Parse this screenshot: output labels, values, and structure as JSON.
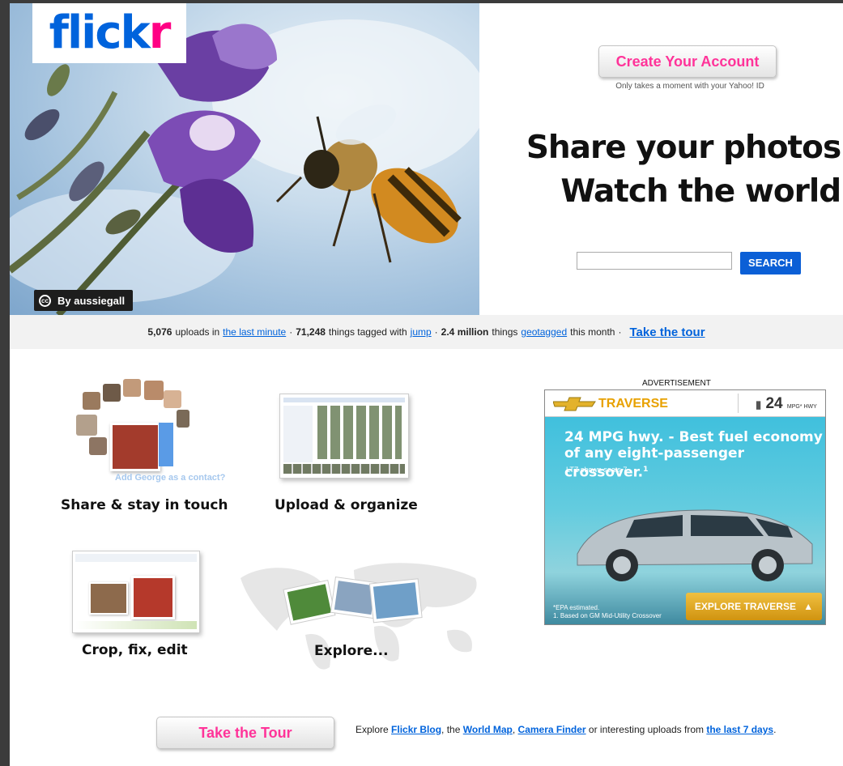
{
  "logo": {
    "flick": "flick",
    "r": "r"
  },
  "hero": {
    "credit": "By aussiegall",
    "cc_icon": "cc-icon"
  },
  "account": {
    "create_label": "Create Your Account",
    "note": "Only takes a moment with your Yahoo! ID"
  },
  "headline": {
    "line1": "Share your photos.",
    "line2": "Watch the world."
  },
  "search": {
    "placeholder": "",
    "button_label": "SEARCH"
  },
  "stats": {
    "uploads_count": "5,076",
    "uploads_text": "uploads in",
    "uploads_link": "the last minute",
    "tagged_count": "71,248",
    "tagged_text": "things tagged with",
    "tagged_link": "jump",
    "geo_count": "2.4 million",
    "geo_text": "things",
    "geo_link": "geotagged",
    "geo_suffix": "this month",
    "tour_link": "Take the tour",
    "separator": "·"
  },
  "features": {
    "share_label": "Share & stay in touch",
    "share_overlay": "Add George as a contact?",
    "upload_label": "Upload & organize",
    "crop_label": "Crop, fix, edit",
    "explore_label": "Explore..."
  },
  "ad": {
    "label": "ADVERTISEMENT",
    "brand": "TRAVERSE",
    "mpg": "24",
    "mpg_unit": "MPG* HWY",
    "headline": "24 MPG hwy. - Best fuel economy of any eight-passenger crossover.",
    "headline_mark": "1",
    "sub": "LTZ shown seats 7.",
    "fine1": "*EPA estimated.",
    "fine2": "1. Based on GM Mid-Utility Crossover",
    "cta": "EXPLORE TRAVERSE"
  },
  "footer": {
    "tour_button": "Take the Tour",
    "explore": "Explore",
    "blog_link": "Flickr Blog",
    "comma_the": ", the",
    "map_link": "World Map",
    "comma": ",",
    "camera_link": "Camera Finder",
    "or_text": "or interesting uploads from",
    "days_link": "the last 7 days",
    "period": "."
  },
  "colors": {
    "flickr_blue": "#0063dc",
    "flickr_pink": "#ff0084",
    "button_pink": "#ff3399",
    "search_blue": "#0b5fd6"
  }
}
